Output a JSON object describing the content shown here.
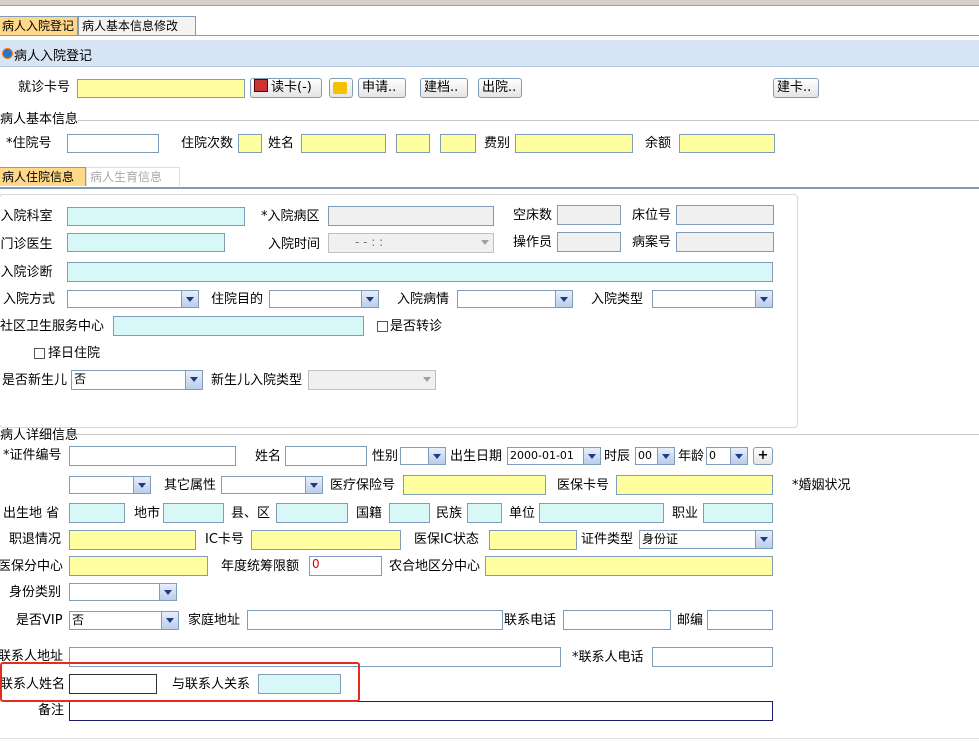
{
  "tabs": [
    {
      "label": "病人入院登记"
    },
    {
      "label": "病人基本信息修改"
    }
  ],
  "panel_title": "病人入院登记",
  "card_row": {
    "card_label": "就诊卡号",
    "card_value": "",
    "read_card": "读卡(-)",
    "apply": "申请..",
    "archive": "建档..",
    "discharge": "出院..",
    "build_card": "建卡.."
  },
  "basic": {
    "section": "病人基本信息",
    "inpatient_no": "*住院号",
    "times": "住院次数",
    "name": "姓名",
    "fee_type": "费别",
    "balance": "余额"
  },
  "subtabs": [
    {
      "label": "病人住院信息"
    },
    {
      "label": "病人生育信息"
    }
  ],
  "admission": {
    "dept": "*入院科室",
    "ward": "*入院病区",
    "empty_beds": "空床数",
    "bed_no": "床位号",
    "outpatient_doctor": "*门诊医生",
    "admit_time": "入院时间",
    "admit_time_value": "- -   : :",
    "operator": "操作员",
    "record_no": "病案号",
    "diagnosis": "*入院诊断",
    "admit_method": "入院方式",
    "purpose": "住院目的",
    "condition": "入院病情",
    "admit_type": "入院类型",
    "community": "社区卫生服务中心",
    "transfer": "是否转诊",
    "scheduled": "择日住院",
    "newborn": "是否新生儿",
    "newborn_value": "否",
    "newborn_type": "新生儿入院类型"
  },
  "detail": {
    "section": "病人详细信息",
    "id_no": "*证件编号",
    "name": "姓名",
    "gender": "性别",
    "birth": "出生日期",
    "birth_value": "2000-01-01",
    "hour": "时辰",
    "hour_value": "00",
    "age": "年龄",
    "age_value": "0",
    "plus": "+",
    "other_attr": "其它属性",
    "insurance_no": "医疗保险号",
    "insurance_card": "医保卡号",
    "marital": "*婚姻状况",
    "birth_province": "出生地 省",
    "city": "地市",
    "county": "县、区",
    "nationality": "国籍",
    "ethnicity": "民族",
    "unit": "单位",
    "occupation": "职业",
    "retire": "职退情况",
    "ic_card": "IC卡号",
    "ic_status": "医保IC状态",
    "id_type": "证件类型",
    "id_type_value": "身份证",
    "center": "医保分中心",
    "annual_limit": "年度统筹限额",
    "annual_limit_value": "0",
    "rural_center": "农合地区分中心",
    "identity": "身份类别",
    "vip": "是否VIP",
    "vip_value": "否",
    "home_addr": "家庭地址",
    "phone": "联系电话",
    "postcode": "邮编",
    "contact_addr": "联系人地址",
    "contact_phone": "*联系人电话",
    "contact_name": "联系人姓名",
    "relation": "与联系人关系",
    "remark": "备注"
  }
}
